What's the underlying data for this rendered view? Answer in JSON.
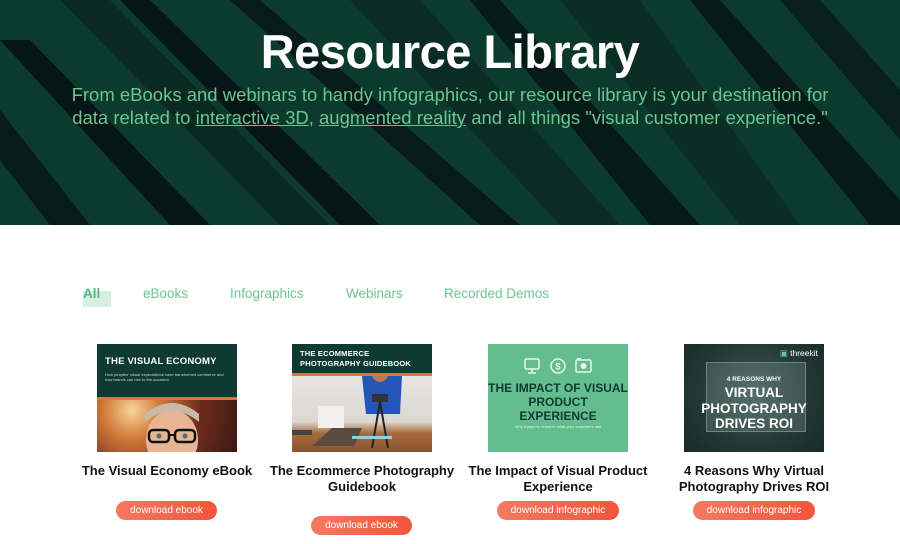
{
  "hero": {
    "title": "Resource Library",
    "subtitle_part1": "From eBooks and webinars to handy infographics, our resource library is your destination for data related to ",
    "link1": "interactive 3D",
    "subtitle_sep": ", ",
    "link2": "augmented reality",
    "subtitle_part2": " and all things \"visual customer experience.\""
  },
  "filters": {
    "active": "All",
    "tabs": [
      {
        "label": "All"
      },
      {
        "label": "eBooks"
      },
      {
        "label": "Infographics"
      },
      {
        "label": "Webinars"
      },
      {
        "label": "Recorded Demos"
      }
    ]
  },
  "colors": {
    "brand_green": "#6cc493",
    "hero_bg": "#0d3b2e",
    "button_accent": "#f2553d"
  },
  "cards": [
    {
      "title": "The Visual Economy eBook",
      "button": "download ebook",
      "thumb_title": "THE VISUAL ECONOMY",
      "thumb_sub": "How peoples' visual expectations have transformed commerce and how brands can rise to the occasion"
    },
    {
      "title": "The Ecommerce Photography Guidebook",
      "button": "download ebook",
      "thumb_title": "THE ECOMMERCE PHOTOGRAPHY GUIDEBOOK"
    },
    {
      "title": "The Impact of Visual Product Experience",
      "button": "download infographic",
      "thumb_title": "THE IMPACT OF VISUAL PRODUCT EXPERIENCE",
      "thumb_sub": "Why it pays to invest in what your customers see"
    },
    {
      "title": "4 Reasons Why Virtual Photography Drives ROI",
      "button": "download infographic",
      "thumb_brand": "threekit",
      "thumb_small": "4 REASONS WHY",
      "thumb_title": "VIRTUAL PHOTOGRAPHY DRIVES ROI"
    }
  ]
}
